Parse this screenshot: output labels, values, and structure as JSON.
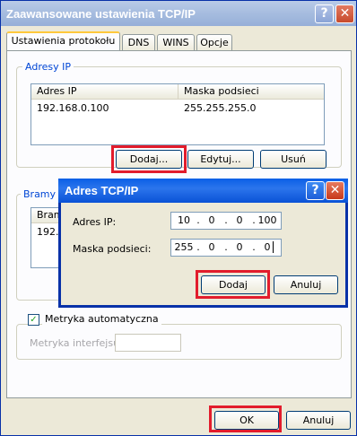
{
  "main_window": {
    "title": "Zaawansowane ustawienia TCP/IP",
    "help_glyph": "?",
    "close_glyph": "✕",
    "tabs": [
      "Ustawienia protokołu IP",
      "DNS",
      "WINS",
      "Opcje"
    ],
    "ip_group": {
      "label": "Adresy IP",
      "columns": [
        "Adres IP",
        "Maska podsieci"
      ],
      "rows": [
        {
          "ip": "192.168.0.100",
          "mask": "255.255.255.0"
        }
      ],
      "buttons": {
        "add": "Dodaj...",
        "edit": "Edytuj...",
        "remove": "Usuń"
      }
    },
    "gateway_group": {
      "label_partial": "Bramy d",
      "column_partial": "Bram",
      "row_partial": "192.1"
    },
    "metric": {
      "checkbox_label": "Metryka automatyczna",
      "checked": true,
      "interface_label": "Metryka interfejsu:"
    },
    "footer": {
      "ok": "OK",
      "cancel": "Anuluj"
    }
  },
  "dialog": {
    "title": "Adres TCP/IP",
    "help_glyph": "?",
    "close_glyph": "✕",
    "ip_label": "Adres IP:",
    "ip_octets": [
      "10",
      "0",
      "0",
      "100"
    ],
    "mask_label": "Maska podsieci:",
    "mask_octets": [
      "255",
      "0",
      "0",
      "0"
    ],
    "dot": ".",
    "buttons": {
      "add": "Dodaj",
      "cancel": "Anuluj"
    }
  },
  "colors": {
    "highlight": "#e21c2c",
    "title_active": "#0a52d6",
    "title_inactive": "#a6bcdf",
    "group_label": "#0046d5"
  }
}
